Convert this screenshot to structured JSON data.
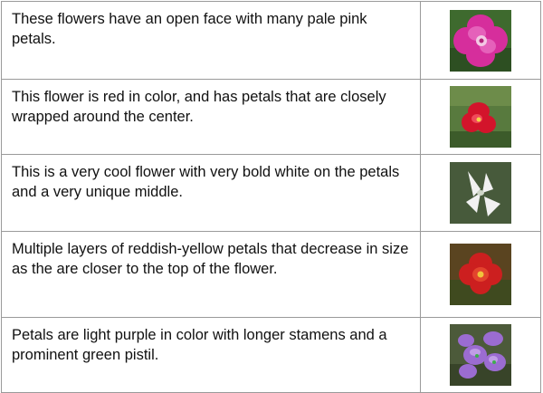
{
  "rows": [
    {
      "text": "These flowers have an open face with many pale pink petals.",
      "image": "pink-flower-image"
    },
    {
      "text": "This flower is red in color, and has petals that are closely wrapped around the center.",
      "image": "red-flower-image"
    },
    {
      "text": "This is a very cool flower with very bold white on the petals and a very unique middle.",
      "image": "white-flower-image"
    },
    {
      "text": "Multiple layers of reddish-yellow petals that decrease in size as the are closer to the top of the flower.",
      "image": "red-yellow-flower-image"
    },
    {
      "text": "Petals are light purple in color with longer stamens and a prominent green pistil.",
      "image": "purple-flower-image"
    }
  ],
  "colors": {
    "border": "#9a9a9a",
    "text": "#111111"
  }
}
